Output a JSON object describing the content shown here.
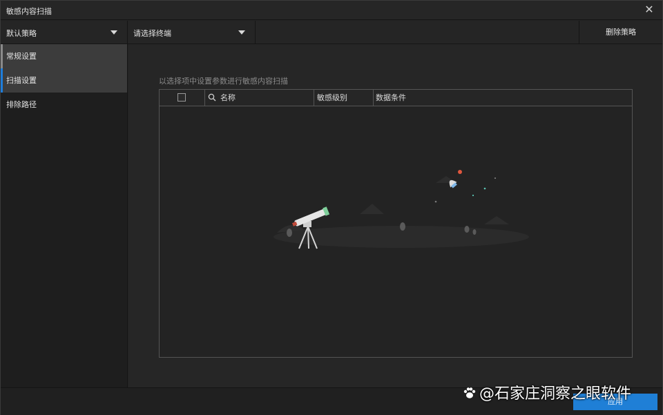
{
  "window": {
    "title": "敏感内容扫描"
  },
  "toolbar": {
    "policy_select": "默认策略",
    "terminal_select": "请选择终端",
    "delete_label": "删除策略"
  },
  "sidebar": {
    "items": [
      {
        "label": "常规设置"
      },
      {
        "label": "扫描设置"
      },
      {
        "label": "排除路径"
      }
    ]
  },
  "main": {
    "hint": "以选择项中设置参数进行敏感内容扫描",
    "table": {
      "columns": [
        "名称",
        "敏感级别",
        "数据条件"
      ],
      "rows": []
    }
  },
  "footer": {
    "apply_label": "应用"
  },
  "watermark": {
    "text": "@石家庄洞察之眼软件"
  },
  "colors": {
    "accent": "#1f7fd6",
    "background": "#232323",
    "border": "#555555"
  }
}
